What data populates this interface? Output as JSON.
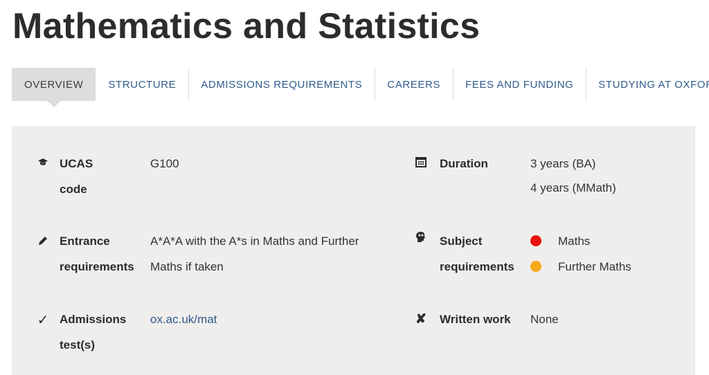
{
  "title": "Mathematics and Statistics",
  "tabs": [
    {
      "label": "OVERVIEW"
    },
    {
      "label": "STRUCTURE"
    },
    {
      "label": "ADMISSIONS REQUIREMENTS"
    },
    {
      "label": "CAREERS"
    },
    {
      "label": "FEES AND FUNDING"
    },
    {
      "label": "STUDYING AT OXFORD"
    }
  ],
  "facts": {
    "ucas": {
      "label": "UCAS code",
      "value": "G100",
      "icon": "graduation-cap-icon"
    },
    "entrance": {
      "label_line1": "Entrance",
      "label_line2": "requirements",
      "value_line1": "A*A*A with the A*s in Maths and Further",
      "value_line2": "Maths if taken",
      "icon": "pencil-icon"
    },
    "admissions_test": {
      "label_line1": "Admissions",
      "label_line2": "test(s)",
      "value": "ox.ac.uk/mat",
      "icon": "check-icon"
    },
    "duration": {
      "label": "Duration",
      "value_line1": "3 years (BA)",
      "value_line2": "4 years (MMath)",
      "icon": "calendar-icon"
    },
    "subject": {
      "label_line1": "Subject",
      "label_line2": "requirements",
      "icon": "head-icon",
      "items": [
        {
          "name": "Maths",
          "color": "#e8120c"
        },
        {
          "name": "Further Maths",
          "color": "#f7a81b"
        }
      ]
    },
    "written_work": {
      "label": "Written work",
      "value": "None",
      "icon": "cross-icon"
    }
  }
}
